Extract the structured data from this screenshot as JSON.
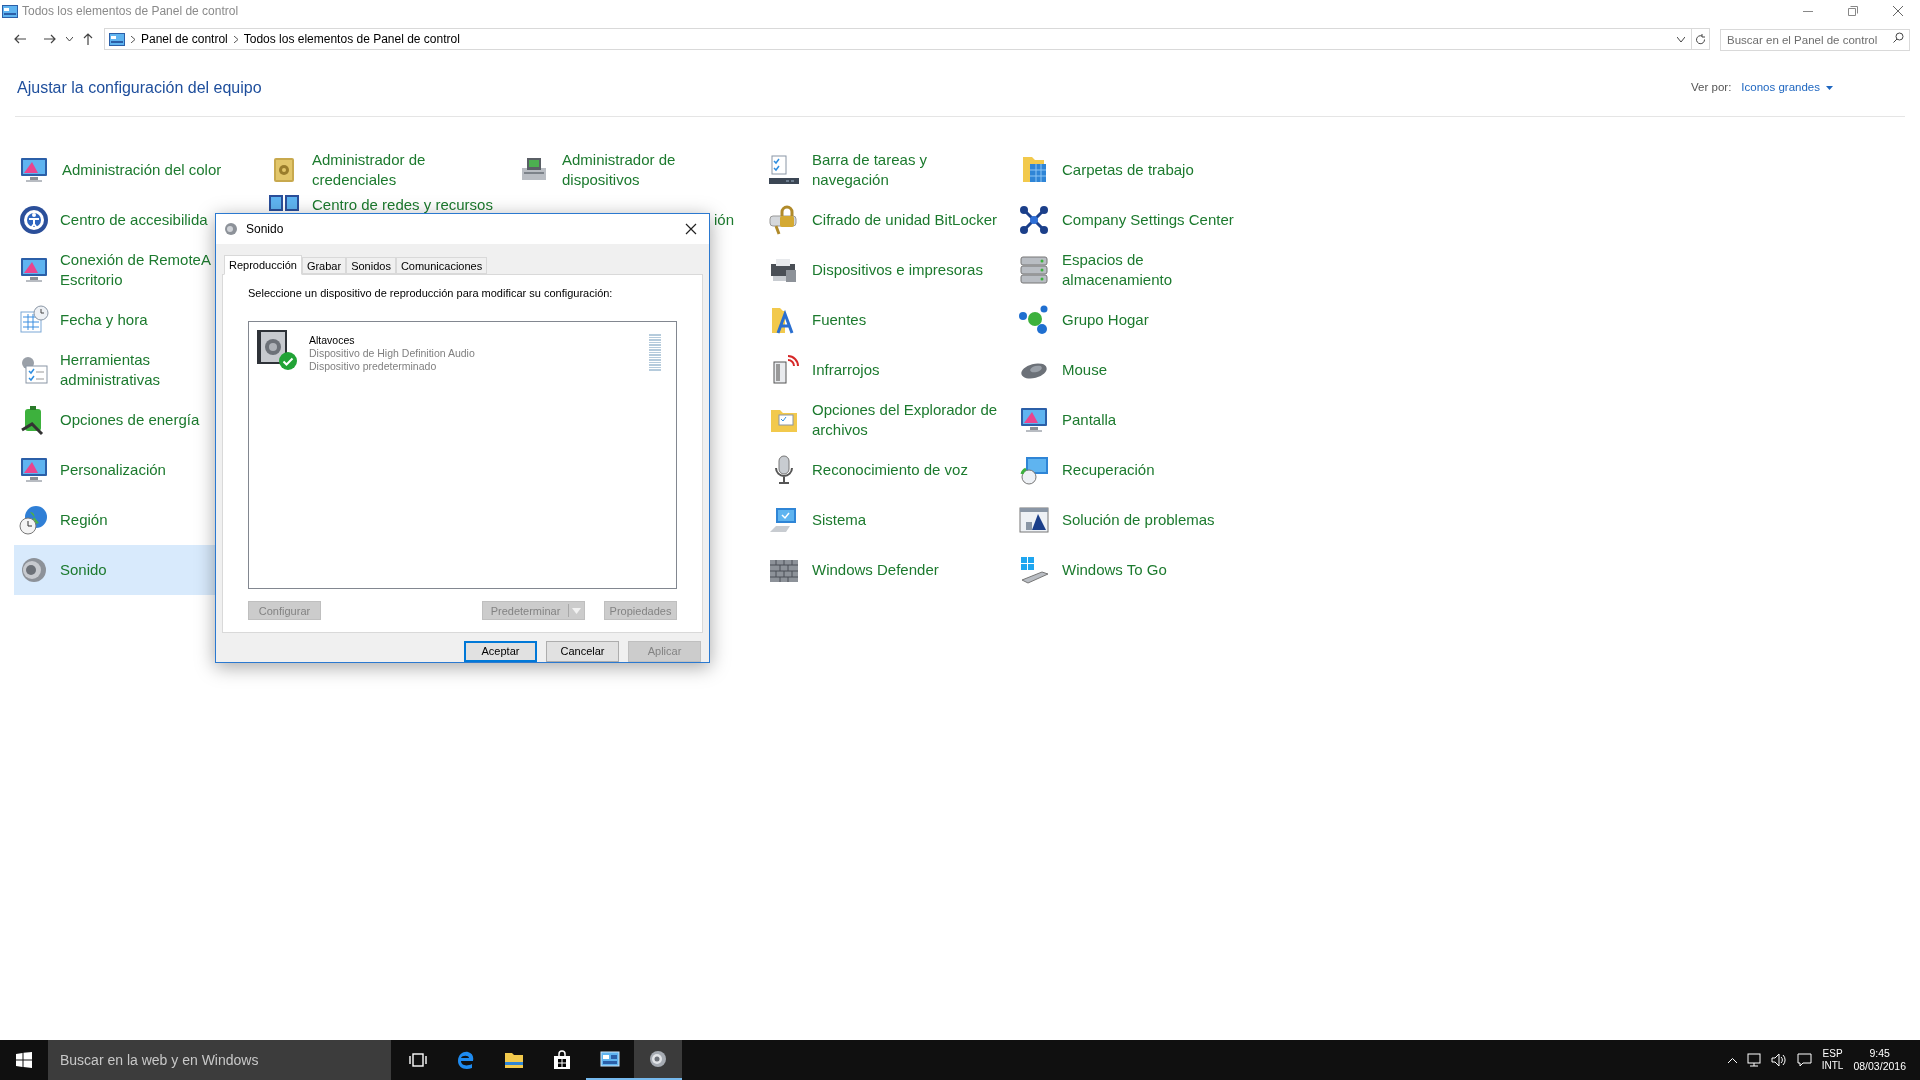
{
  "window": {
    "title": "Todos los elementos de Panel de control"
  },
  "address_bar": {
    "path": [
      "Panel de control",
      "Todos los elementos de Panel de control"
    ]
  },
  "search": {
    "placeholder": "Buscar en el Panel de control"
  },
  "header": {
    "title": "Ajustar la configuración del equipo",
    "view_label": "Ver por:",
    "view_value": "Iconos grandes"
  },
  "columns": [
    {
      "items": [
        {
          "label": "Administración del color",
          "kind": "link",
          "selected": false
        },
        {
          "label": "Centro de accesibilida",
          "kind": "link",
          "selected": false
        },
        {
          "label": "Conexión de RemoteA Escritorio",
          "kind": "link",
          "selected": false
        },
        {
          "label": "Fecha y hora",
          "kind": "link",
          "selected": false
        },
        {
          "label": "Herramientas administrativas",
          "kind": "link",
          "selected": false
        },
        {
          "label": "Opciones de energía",
          "kind": "link",
          "selected": false
        },
        {
          "label": "Personalización",
          "kind": "link",
          "selected": false
        },
        {
          "label": "Región",
          "kind": "link",
          "selected": false
        },
        {
          "label": "Sonido",
          "kind": "link",
          "selected": true
        }
      ]
    },
    {
      "items": [
        {
          "label": "Administrador de credenciales",
          "kind": "link",
          "selected": false
        },
        {
          "label": "Centro de redes y recursos",
          "kind": "link",
          "selected": false
        }
      ]
    },
    {
      "items": [
        {
          "label": "Administrador de dispositivos",
          "kind": "link",
          "selected": false
        },
        {
          "label": "ión",
          "kind": "fragment",
          "selected": false
        }
      ]
    },
    {
      "items": [
        {
          "label": "Barra de tareas y navegación",
          "kind": "link",
          "selected": false
        },
        {
          "label": "Cifrado de unidad BitLocker",
          "kind": "link",
          "selected": false
        },
        {
          "label": "Dispositivos e impresoras",
          "kind": "link",
          "selected": false
        },
        {
          "label": "Fuentes",
          "kind": "link",
          "selected": false
        },
        {
          "label": "Infrarrojos",
          "kind": "link",
          "selected": false
        },
        {
          "label": "Opciones del Explorador de archivos",
          "kind": "link",
          "selected": false
        },
        {
          "label": "Reconocimiento de voz",
          "kind": "link",
          "selected": false
        },
        {
          "label": "Sistema",
          "kind": "link",
          "selected": false
        },
        {
          "label": "Windows Defender",
          "kind": "link",
          "selected": false
        }
      ]
    },
    {
      "items": [
        {
          "label": "Carpetas de trabajo",
          "kind": "link",
          "selected": false
        },
        {
          "label": "Company Settings Center",
          "kind": "link",
          "selected": false
        },
        {
          "label": "Espacios de almacenamiento",
          "kind": "link",
          "selected": false
        },
        {
          "label": "Grupo Hogar",
          "kind": "link",
          "selected": false
        },
        {
          "label": "Mouse",
          "kind": "link",
          "selected": false
        },
        {
          "label": "Pantalla",
          "kind": "link",
          "selected": false
        },
        {
          "label": "Recuperación",
          "kind": "link",
          "selected": false
        },
        {
          "label": "Solución de problemas",
          "kind": "link",
          "selected": false
        },
        {
          "label": "Windows To Go",
          "kind": "link",
          "selected": false
        }
      ]
    }
  ],
  "dialog": {
    "title": "Sonido",
    "tabs": [
      {
        "label": "Reproducción",
        "selected": true
      },
      {
        "label": "Grabar",
        "selected": false
      },
      {
        "label": "Sonidos",
        "selected": false
      },
      {
        "label": "Comunicaciones",
        "selected": false
      }
    ],
    "instruction": "Seleccione un dispositivo de reproducción para modificar su configuración:",
    "devices": [
      {
        "name": "Altavoces",
        "description": "Dispositivo de High Definition Audio",
        "status": "Dispositivo predeterminado",
        "default": true,
        "level": 0
      }
    ],
    "actions": [
      {
        "label": "Configurar",
        "kind": "plain",
        "disabled": true
      },
      {
        "label": "Predeterminar",
        "kind": "split",
        "disabled": true
      },
      {
        "label": "Propiedades",
        "kind": "plain",
        "disabled": true
      }
    ],
    "buttons": [
      {
        "label": "Aceptar",
        "default": true,
        "disabled": false
      },
      {
        "label": "Cancelar",
        "default": false,
        "disabled": false
      },
      {
        "label": "Aplicar",
        "default": false,
        "disabled": true
      }
    ]
  },
  "taskbar": {
    "search_placeholder": "Buscar en la web y en Windows",
    "apps": [
      {
        "active": false,
        "selected": false
      },
      {
        "active": false,
        "selected": false
      },
      {
        "active": false,
        "selected": false
      },
      {
        "active": false,
        "selected": false
      },
      {
        "active": true,
        "selected": false
      },
      {
        "active": true,
        "selected": true
      }
    ],
    "tray": {
      "language": "ESP",
      "layout": "INTL",
      "time": "9:45",
      "date": "08/03/2016"
    }
  }
}
